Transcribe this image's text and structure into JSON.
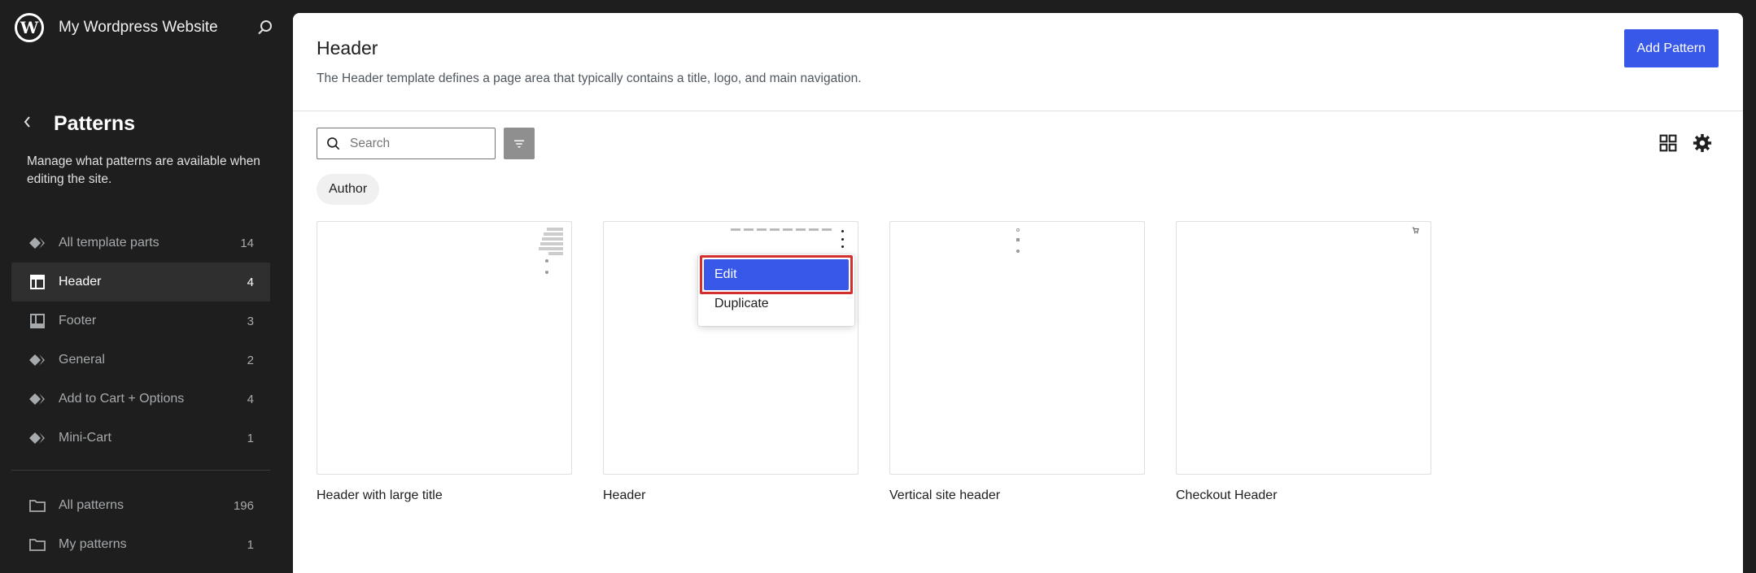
{
  "site": {
    "title": "My Wordpress Website"
  },
  "sidebar": {
    "title": "Patterns",
    "description": "Manage what patterns are available when editing the site.",
    "items": [
      {
        "label": "All template parts",
        "count": "14",
        "icon": "diamond-stack-icon"
      },
      {
        "label": "Header",
        "count": "4",
        "icon": "header-layout-icon"
      },
      {
        "label": "Footer",
        "count": "3",
        "icon": "footer-layout-icon"
      },
      {
        "label": "General",
        "count": "2",
        "icon": "diamond-stack-icon"
      },
      {
        "label": "Add to Cart + Options",
        "count": "4",
        "icon": "diamond-stack-icon"
      },
      {
        "label": "Mini-Cart",
        "count": "1",
        "icon": "diamond-stack-icon"
      }
    ],
    "items2": [
      {
        "label": "All patterns",
        "count": "196",
        "icon": "folder-icon"
      },
      {
        "label": "My patterns",
        "count": "1",
        "icon": "folder-icon"
      }
    ]
  },
  "main": {
    "title": "Header",
    "description": "The Header template defines a page area that typically contains a title, logo, and main navigation.",
    "add_label": "Add Pattern",
    "search_placeholder": "Search",
    "author_chip": "Author",
    "cards": [
      {
        "label": "Header with large title"
      },
      {
        "label": "Header"
      },
      {
        "label": "Vertical site header"
      },
      {
        "label": "Checkout Header"
      }
    ],
    "menu": {
      "edit": "Edit",
      "duplicate": "Duplicate"
    }
  },
  "colors": {
    "accent": "#3858e9",
    "sidebar_bg": "#1e1e1e",
    "highlight": "#d32f2f"
  }
}
